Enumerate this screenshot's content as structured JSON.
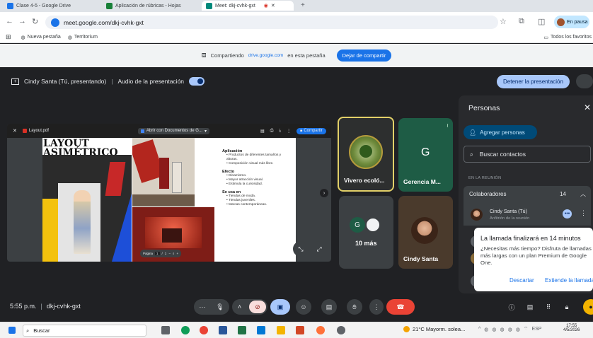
{
  "browser": {
    "tabs": [
      {
        "label": "Clase 4-5 - Google Drive",
        "color": "#1a73e8"
      },
      {
        "label": "Aplicación de rúbricas - Hojas",
        "color": "#188038"
      },
      {
        "label": "Meet: dkj-cvhk-gxt",
        "color": "#00897b"
      }
    ],
    "url": "meet.google.com/dkj-cvhk-gxt",
    "pause_label": "En pausa",
    "bookmarks": [
      "Nueva pestaña",
      "Territorium"
    ],
    "all_bookmarks": "Todos los favoritos"
  },
  "share_bar": {
    "sharing_text": "Compartiendo",
    "domain": "drive.google.com",
    "suffix": "en esta pestaña",
    "stop_label": "Dejar de compartir"
  },
  "meet": {
    "presenter_text": "Cindy Santa (Tú, presentando)",
    "audio_label": "Audio de la presentación",
    "stop_presenting": "Detener la presentación",
    "time": "5:55 p.m.",
    "meeting_code": "dkj-cvhk-gxt"
  },
  "presentation": {
    "file_name": "Layout.pdf",
    "open_with": "Abrir con Documentos de G...",
    "share": "Compartir",
    "slide": {
      "title_line1": "LAYOUT",
      "title_line2": "ASIMÉTRICO",
      "sections": [
        {
          "heading": "Aplicación",
          "items": [
            "Productos de diferentes tamaños y alturas.",
            "Composición visual más libre."
          ]
        },
        {
          "heading": "Efecto",
          "items": [
            "Dinamismo.",
            "Mayor atracción visual.",
            "Estimula la curiosidad."
          ]
        },
        {
          "heading": "Se usa en",
          "items": [
            "Tiendas de moda.",
            "Tiendas juveniles.",
            "Marcas contemporáneas."
          ]
        }
      ]
    },
    "page_label": "Página",
    "page_num": "1",
    "page_sep": "/",
    "page_total": "1"
  },
  "tiles": {
    "vivero": "Vivero ecoló...",
    "gerencia": "Gerencia M...",
    "gerencia_letter": "G",
    "more": "10 más",
    "more_letter": "G",
    "cindy": "Cindy Santa"
  },
  "people_panel": {
    "title": "Personas",
    "add_people": "Agregar personas",
    "search_placeholder": "Buscar contactos",
    "in_meeting": "EN LA REUNIÓN",
    "collaborators": "Colaboradores",
    "count": "14",
    "host_name": "Cindy Santa (Tú)",
    "host_role": "Anfitrión de la reunión"
  },
  "toast": {
    "title": "La llamada finalizará en 14 minutos",
    "body": "¿Necesitas más tiempo? Disfruta de llamadas más largas con un plan Premium de Google One.",
    "dismiss": "Descartar",
    "extend": "Extiende la llamada"
  },
  "taskbar": {
    "search": "Buscar",
    "weather": "21°C Mayorm. solea...",
    "lang": "ESP",
    "clock_time": "17:55",
    "clock_date": "4/5/2026"
  },
  "colors": {
    "accent": "#a8c7fa",
    "end_call": "#ea4335",
    "vivero_border": "#e2d068",
    "gerencia_tile": "#1e5c45",
    "more_tile": "#3c4043",
    "cindy_tile": "#4a3a2c"
  }
}
